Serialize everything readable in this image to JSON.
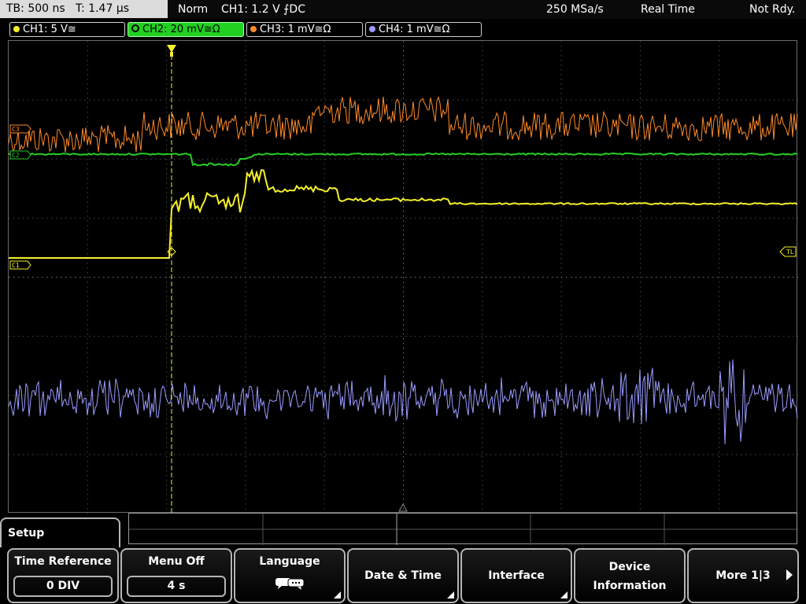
{
  "status_bar": {
    "timebase": "TB: 500 ns   T: 1.47 µs",
    "mode": "Norm",
    "trigger": "CH1: 1.2 V ⨍DC",
    "sample_rate": "250 MSa/s",
    "acq_mode": "Real Time",
    "state": "Not Rdy."
  },
  "channels": [
    {
      "label": "CH1: 5 V≅",
      "color": "#f5f02a",
      "active": false
    },
    {
      "label": "CH2: 20 mV≅Ω",
      "color": "#22d022",
      "active": true
    },
    {
      "label": "CH3: 1 mV≅Ω",
      "color": "#ff8a2a",
      "active": false
    },
    {
      "label": "CH4: 1 mV≅Ω",
      "color": "#9a9cff",
      "active": false
    }
  ],
  "markers": {
    "c3": "C3",
    "c2": "C2",
    "c1": "C1",
    "tl": "TL"
  },
  "menu": {
    "title": "Setup",
    "time_reference": {
      "label": "Time Reference",
      "value": "0 DIV"
    },
    "menu_off": {
      "label": "Menu Off",
      "value": "4 s"
    },
    "language": {
      "label": "Language",
      "icon": "speech-bubbles-icon"
    },
    "date_time": {
      "label": "Date & Time"
    },
    "interface": {
      "label": "Interface"
    },
    "device_info": {
      "line1": "Device",
      "line2": "Information"
    },
    "more": {
      "label": "More 1|3"
    }
  },
  "colors": {
    "ch1": "#f5f02a",
    "ch2": "#22d022",
    "ch3": "#ff8a2a",
    "ch4": "#9a9cff",
    "grid": "#4a4a4a"
  }
}
